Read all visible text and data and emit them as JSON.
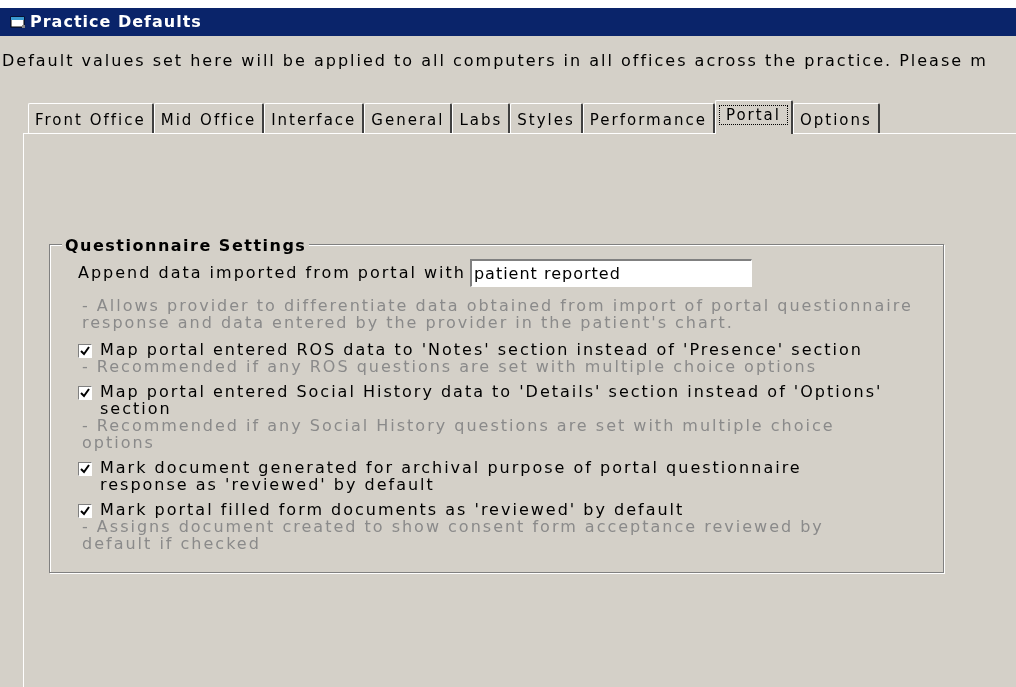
{
  "window": {
    "title": "Practice Defaults"
  },
  "description": "Default values set here will be applied to all computers in all offices across the practice. Please m",
  "tabs": [
    {
      "label": "Front Office",
      "selected": false
    },
    {
      "label": "Mid Office",
      "selected": false
    },
    {
      "label": "Interface",
      "selected": false
    },
    {
      "label": "General",
      "selected": false
    },
    {
      "label": "Labs",
      "selected": false
    },
    {
      "label": "Styles",
      "selected": false
    },
    {
      "label": "Performance",
      "selected": false
    },
    {
      "label": "Portal",
      "selected": true
    },
    {
      "label": "Options",
      "selected": false
    }
  ],
  "group": {
    "title": "Questionnaire Settings",
    "append_field": {
      "label": "Append data imported from portal with",
      "value": "patient reported",
      "hint": " - Allows provider to differentiate data obtained from import of portal questionnaire response and data entered by the provider in the patient's chart."
    },
    "options": [
      {
        "label": "Map portal entered ROS data to 'Notes' section instead of 'Presence' section",
        "checked": true,
        "hint": " - Recommended if any ROS questions are set with multiple choice options"
      },
      {
        "label": "Map portal entered Social History data to 'Details' section instead of 'Options' section",
        "checked": true,
        "hint": " - Recommended if any Social History questions are set with multiple choice options"
      },
      {
        "label": "Mark document generated for archival purpose of portal questionnaire response as 'reviewed'  by default",
        "checked": true
      },
      {
        "label": "Mark portal filled form documents as 'reviewed' by default",
        "checked": true,
        "hint": " - Assigns document created to show consent form acceptance reviewed by default if checked"
      }
    ]
  }
}
